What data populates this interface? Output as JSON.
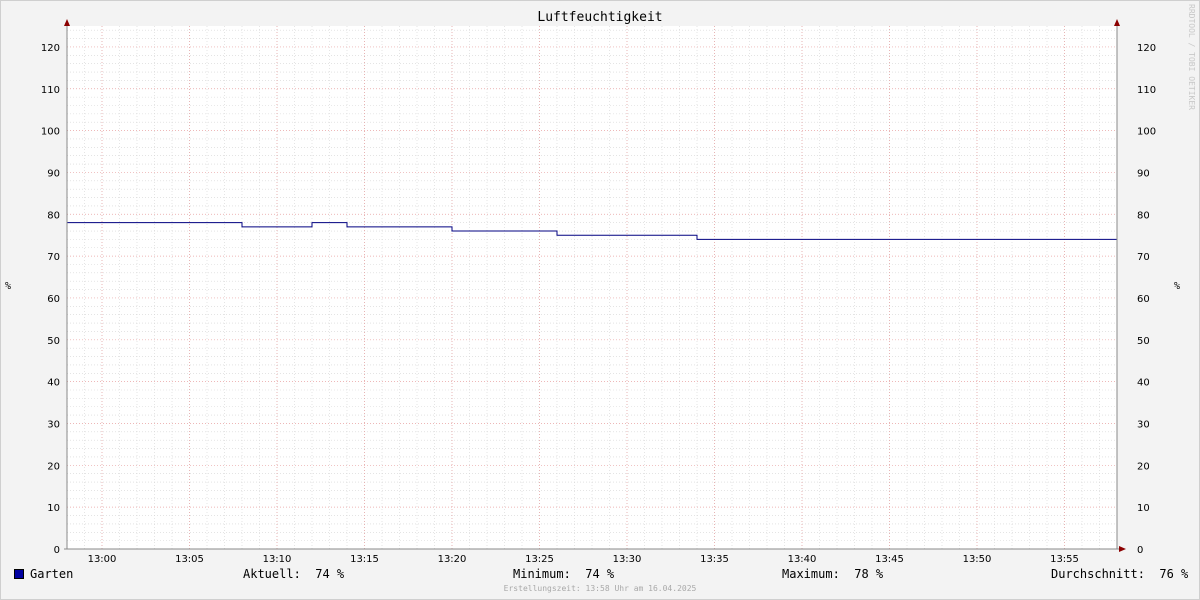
{
  "chart_data": {
    "type": "line",
    "title": "Luftfeuchtigkeit",
    "ylabel": "%",
    "ylabel_right": "%",
    "ylim": [
      0,
      125
    ],
    "yticks": [
      0,
      10,
      20,
      30,
      40,
      50,
      60,
      70,
      80,
      90,
      100,
      110,
      120
    ],
    "xlim": [
      "12:58",
      "13:58"
    ],
    "xticks": [
      "13:00",
      "13:05",
      "13:10",
      "13:15",
      "13:20",
      "13:25",
      "13:30",
      "13:35",
      "13:40",
      "13:45",
      "13:50",
      "13:55"
    ],
    "grid": true,
    "step": true,
    "series": [
      {
        "name": "Garten",
        "color": "#000080",
        "x": [
          "12:58",
          "13:08",
          "13:12",
          "13:14",
          "13:20",
          "13:26",
          "13:34",
          "13:36",
          "13:58"
        ],
        "values": [
          78,
          77,
          78,
          77,
          76,
          75,
          74,
          74,
          74
        ]
      }
    ]
  },
  "legend": {
    "swatch_color": "#0000a0",
    "name": "Garten",
    "current": "Aktuell:  74 %",
    "minimum": "Minimum:  74 %",
    "maximum": "Maximum:  78 %",
    "average": "Durchschnitt:  76 %"
  },
  "watermark": "RRDTOOL / TOBI OETIKER",
  "footer": "Erstellungszeit: 13:58 Uhr am 16.04.2025"
}
